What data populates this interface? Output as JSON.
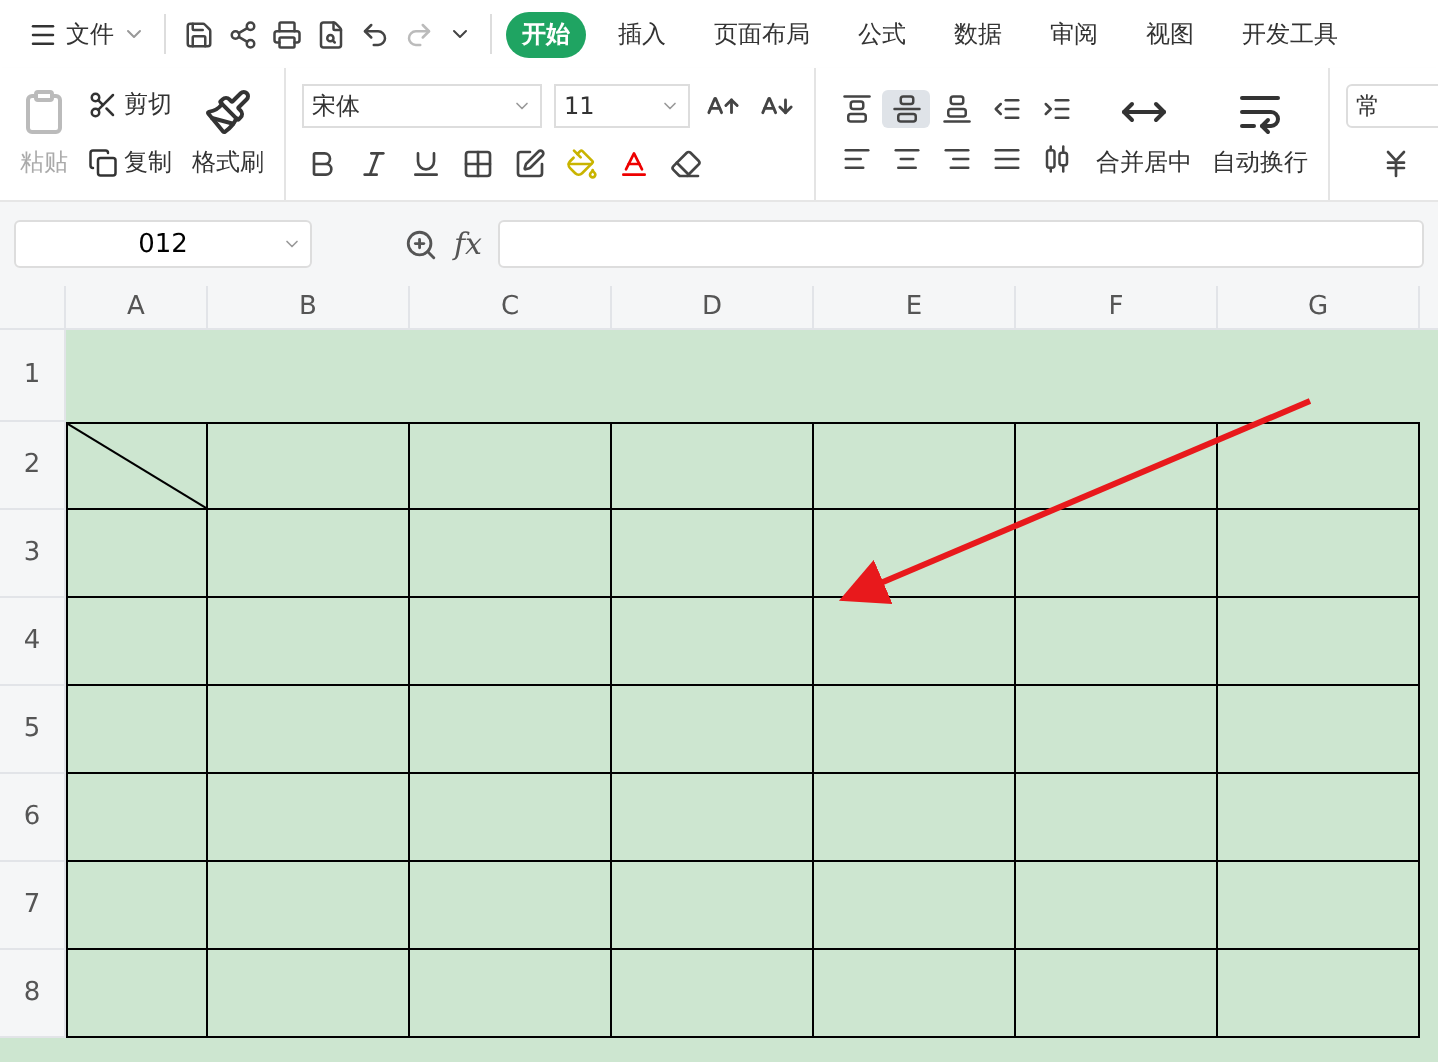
{
  "menu": {
    "label": "文件"
  },
  "tabs": [
    {
      "label": "开始",
      "selected": true
    },
    {
      "label": "插入",
      "selected": false
    },
    {
      "label": "页面布局",
      "selected": false
    },
    {
      "label": "公式",
      "selected": false
    },
    {
      "label": "数据",
      "selected": false
    },
    {
      "label": "审阅",
      "selected": false
    },
    {
      "label": "视图",
      "selected": false
    },
    {
      "label": "开发工具",
      "selected": false
    }
  ],
  "quick_access": [
    {
      "kind": "save",
      "disabled": false
    },
    {
      "kind": "share",
      "disabled": false
    },
    {
      "kind": "print",
      "disabled": false
    },
    {
      "kind": "preview",
      "disabled": false
    },
    {
      "kind": "undo",
      "disabled": false
    },
    {
      "kind": "redo",
      "disabled": true
    },
    {
      "kind": "more",
      "disabled": false
    }
  ],
  "clipboard": {
    "paste": {
      "label": "粘贴",
      "disabled": true
    },
    "cut": {
      "label": "剪切"
    },
    "copy": {
      "label": "复制"
    },
    "format_painter": {
      "label": "格式刷"
    }
  },
  "font": {
    "name": "宋体",
    "size": "11"
  },
  "align_buttons": [
    {
      "kind": "top",
      "selected": false
    },
    {
      "kind": "middle",
      "selected": true
    },
    {
      "kind": "bottom",
      "selected": false
    },
    {
      "kind": "outdent",
      "selected": false
    },
    {
      "kind": "indent",
      "selected": false
    },
    {
      "kind": "left",
      "selected": false
    },
    {
      "kind": "center",
      "selected": false
    },
    {
      "kind": "right",
      "selected": false
    },
    {
      "kind": "justify",
      "selected": false
    },
    {
      "kind": "distribute",
      "selected": false
    }
  ],
  "merge": {
    "label": "合并居中"
  },
  "wrap": {
    "label": "自动换行"
  },
  "number_format": {
    "value": "常"
  },
  "formula_bar": {
    "name_box": "012",
    "fx": "fx"
  },
  "columns": [
    "A",
    "B",
    "C",
    "D",
    "E",
    "F",
    "G"
  ],
  "rows": [
    {
      "label": "1",
      "bordered": false,
      "diagonal": false
    },
    {
      "label": "2",
      "bordered": true,
      "diagonal": true
    },
    {
      "label": "3",
      "bordered": true,
      "diagonal": false
    },
    {
      "label": "4",
      "bordered": true,
      "diagonal": false
    },
    {
      "label": "5",
      "bordered": true,
      "diagonal": false
    },
    {
      "label": "6",
      "bordered": true,
      "diagonal": false
    },
    {
      "label": "7",
      "bordered": true,
      "diagonal": false
    },
    {
      "label": "8",
      "bordered": true,
      "diagonal": false
    }
  ]
}
